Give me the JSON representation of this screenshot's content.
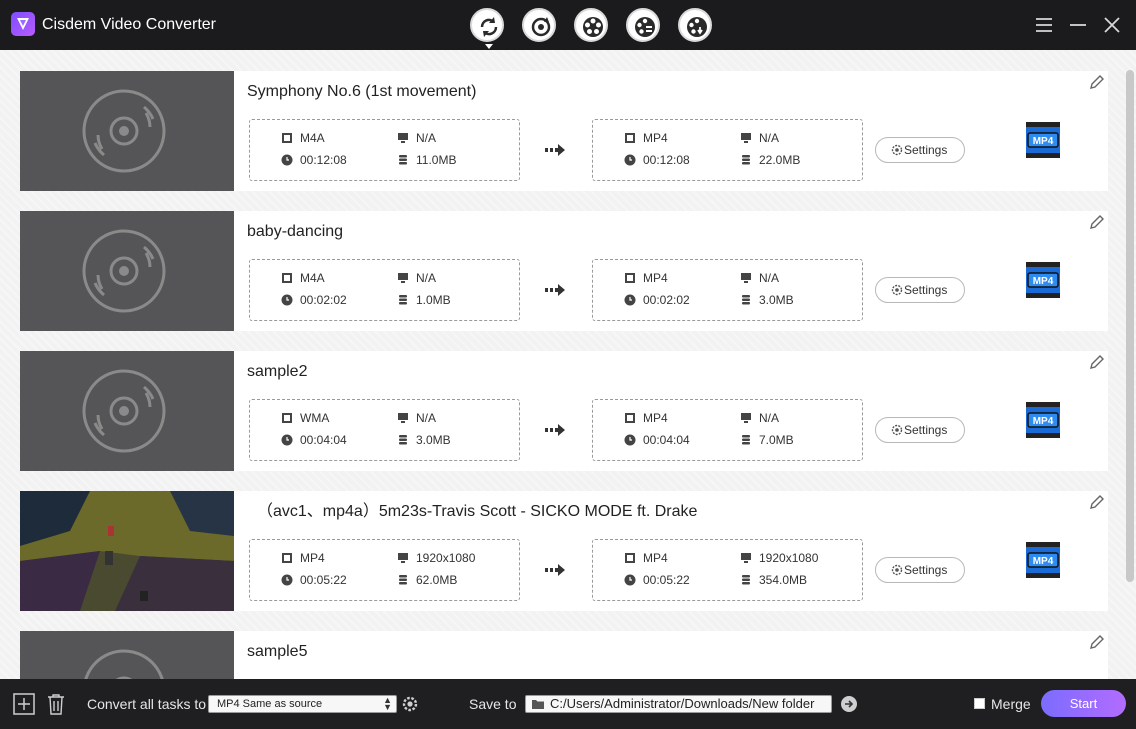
{
  "app": {
    "title": "Cisdem Video Converter",
    "logo_icon": "cisdem-logo-icon"
  },
  "modes": [
    {
      "name": "convert-mode-icon",
      "active": true
    },
    {
      "name": "rip-mode-icon",
      "active": false
    },
    {
      "name": "compress-mode-icon",
      "active": false
    },
    {
      "name": "edit-mode-icon",
      "active": false
    },
    {
      "name": "download-mode-icon",
      "active": false
    }
  ],
  "window_controls": [
    "menu-icon",
    "minimize-icon",
    "close-icon"
  ],
  "tasks": [
    {
      "title": "Symphony No.6 (1st movement)",
      "thumbnail": "disc",
      "source": {
        "format": "M4A",
        "resolution": "N/A",
        "duration": "00:12:08",
        "size": "11.0MB"
      },
      "target": {
        "format": "MP4",
        "resolution": "N/A",
        "duration": "00:12:08",
        "size": "22.0MB"
      },
      "settings_label": "Settings",
      "format_badge": "MP4"
    },
    {
      "title": "baby-dancing",
      "thumbnail": "disc",
      "source": {
        "format": "M4A",
        "resolution": "N/A",
        "duration": "00:02:02",
        "size": "1.0MB"
      },
      "target": {
        "format": "MP4",
        "resolution": "N/A",
        "duration": "00:02:02",
        "size": "3.0MB"
      },
      "settings_label": "Settings",
      "format_badge": "MP4"
    },
    {
      "title": "sample2",
      "thumbnail": "disc",
      "source": {
        "format": "WMA",
        "resolution": "N/A",
        "duration": "00:04:04",
        "size": "3.0MB"
      },
      "target": {
        "format": "MP4",
        "resolution": "N/A",
        "duration": "00:04:04",
        "size": "7.0MB"
      },
      "settings_label": "Settings",
      "format_badge": "MP4"
    },
    {
      "title": "（avc1、mp4a）5m23s-Travis Scott - SICKO MODE ft. Drake",
      "thumbnail": "video",
      "source": {
        "format": "MP4",
        "resolution": "1920x1080",
        "duration": "00:05:22",
        "size": "62.0MB"
      },
      "target": {
        "format": "MP4",
        "resolution": "1920x1080",
        "duration": "00:05:22",
        "size": "354.0MB"
      },
      "settings_label": "Settings",
      "format_badge": "MP4"
    },
    {
      "title": "sample5",
      "thumbnail": "disc"
    }
  ],
  "bottom": {
    "add_icon": "add-file-icon",
    "delete_icon": "trash-icon",
    "convert_all_label": "Convert all tasks to",
    "convert_all_value": "MP4 Same as source",
    "save_to_label": "Save to",
    "save_path": "C:/Users/Administrator/Downloads/New folder",
    "merge_label": "Merge",
    "merge_checked": false,
    "start_label": "Start"
  },
  "colors": {
    "titlebar": "#1b1b1e",
    "content_bg": "#f2f2f2",
    "start_gradient_from": "#7b6cff",
    "start_gradient_to": "#b26cff"
  }
}
